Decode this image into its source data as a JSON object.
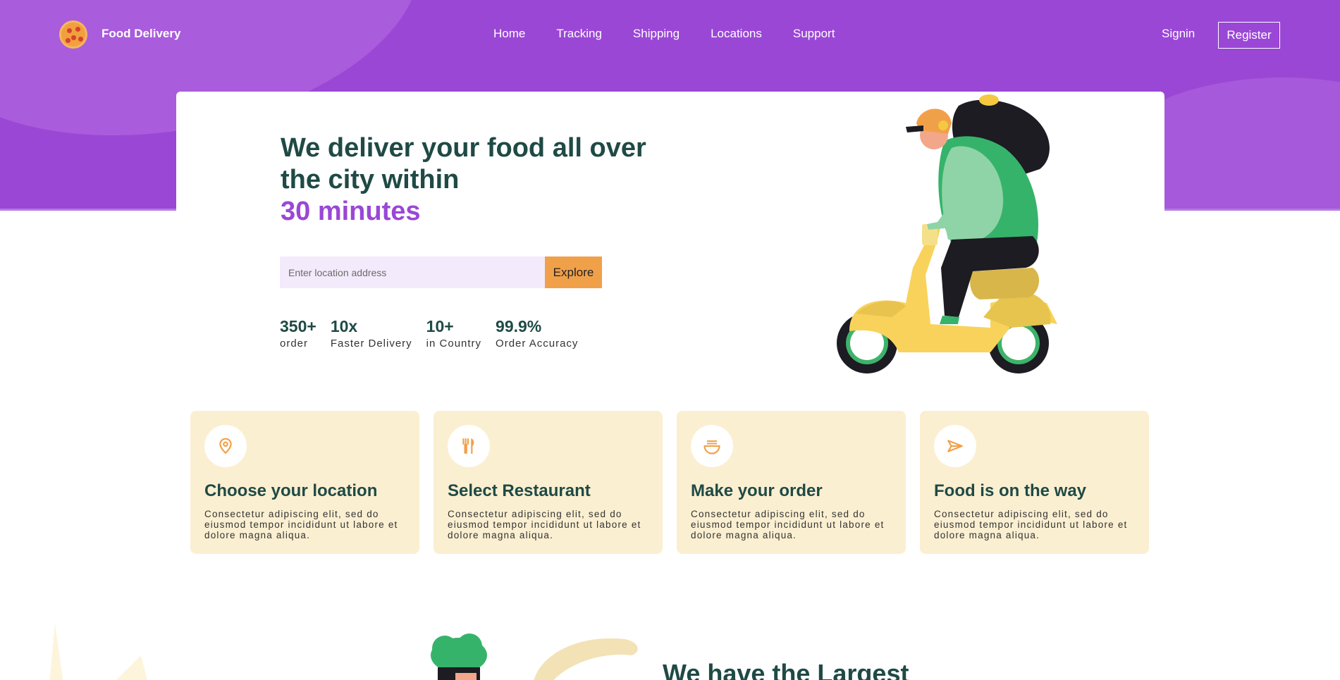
{
  "brand": {
    "name": "Food Delivery",
    "logo_icon": "pizza-icon"
  },
  "nav": {
    "links": [
      "Home",
      "Tracking",
      "Shipping",
      "Locations",
      "Support"
    ],
    "signin": "Signin",
    "register": "Register"
  },
  "hero": {
    "headline": "We deliver your food all over the city within",
    "headline_accent": "30 minutes",
    "search": {
      "placeholder": "Enter location address",
      "value": ""
    },
    "explore_button": "Explore",
    "stats": [
      {
        "value": "350+",
        "label": "order"
      },
      {
        "value": "10x",
        "label": "Faster Delivery"
      },
      {
        "value": "10+",
        "label": "in Country"
      },
      {
        "value": "99.9%",
        "label": "Order Accuracy"
      }
    ]
  },
  "features": [
    {
      "icon": "location-pin-icon",
      "title": "Choose your location",
      "desc": "Consectetur adipiscing elit, sed do eiusmod tempor incididunt ut labore et dolore magna aliqua."
    },
    {
      "icon": "fork-knife-icon",
      "title": "Select Restaurant",
      "desc": "Consectetur adipiscing elit, sed do eiusmod tempor incididunt ut labore et dolore magna aliqua."
    },
    {
      "icon": "noodle-bowl-icon",
      "title": "Make your order",
      "desc": "Consectetur adipiscing elit, sed do eiusmod tempor incididunt ut labore et dolore magna aliqua."
    },
    {
      "icon": "send-icon",
      "title": "Food is on the way",
      "desc": "Consectetur adipiscing elit, sed do eiusmod tempor incididunt ut labore et dolore magna aliqua."
    }
  ],
  "next_section": {
    "title": "We have the Largest"
  },
  "colors": {
    "primary": "#9a47d6",
    "accent": "#f1a04a",
    "heading": "#1f4a45",
    "card": "#fbefd1"
  }
}
